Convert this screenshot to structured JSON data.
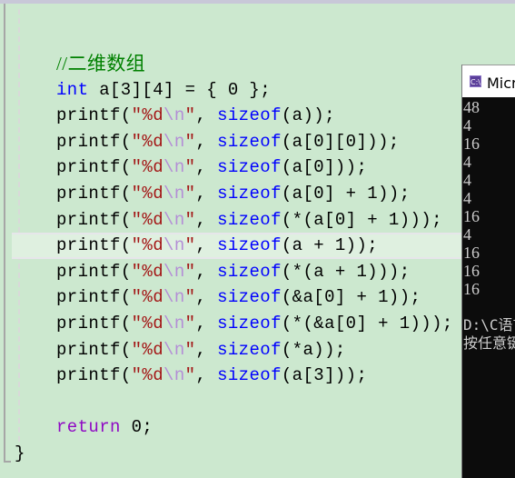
{
  "editor": {
    "comment": "//二维数组",
    "declaration": {
      "type": "int",
      "rest": " a[3][4] = { 0 };"
    },
    "printf_lines": [
      {
        "fn": "printf",
        "open": "(",
        "str_start": "″%d",
        "esc": "\\n",
        "str_end": "″",
        "sep": ", ",
        "sizeof": "sizeof",
        "arg": "(a));"
      },
      {
        "fn": "printf",
        "open": "(",
        "str_start": "″%d",
        "esc": "\\n",
        "str_end": "″",
        "sep": ", ",
        "sizeof": "sizeof",
        "arg": "(a[0][0]));"
      },
      {
        "fn": "printf",
        "open": "(",
        "str_start": "″%d",
        "esc": "\\n",
        "str_end": "″",
        "sep": ", ",
        "sizeof": "sizeof",
        "arg": "(a[0]));"
      },
      {
        "fn": "printf",
        "open": "(",
        "str_start": "″%d",
        "esc": "\\n",
        "str_end": "″",
        "sep": ", ",
        "sizeof": "sizeof",
        "arg": "(a[0] + 1));"
      },
      {
        "fn": "printf",
        "open": "(",
        "str_start": "″%d",
        "esc": "\\n",
        "str_end": "″",
        "sep": ", ",
        "sizeof": "sizeof",
        "arg": "(*(a[0] + 1)));"
      },
      {
        "fn": "printf",
        "open": "(",
        "str_start": "″%d",
        "esc": "\\n",
        "str_end": "″",
        "sep": ", ",
        "sizeof": "sizeof",
        "arg": "(a + 1));"
      },
      {
        "fn": "printf",
        "open": "(",
        "str_start": "″%d",
        "esc": "\\n",
        "str_end": "″",
        "sep": ", ",
        "sizeof": "sizeof",
        "arg": "(*(a + 1)));"
      },
      {
        "fn": "printf",
        "open": "(",
        "str_start": "″%d",
        "esc": "\\n",
        "str_end": "″",
        "sep": ", ",
        "sizeof": "sizeof",
        "arg": "(&a[0] + 1));"
      },
      {
        "fn": "printf",
        "open": "(",
        "str_start": "″%d",
        "esc": "\\n",
        "str_end": "″",
        "sep": ", ",
        "sizeof": "sizeof",
        "arg": "(*(&a[0] + 1)));"
      },
      {
        "fn": "printf",
        "open": "(",
        "str_start": "″%d",
        "esc": "\\n",
        "str_end": "″",
        "sep": ", ",
        "sizeof": "sizeof",
        "arg": "(*a));"
      },
      {
        "fn": "printf",
        "open": "(",
        "str_start": "″%d",
        "esc": "\\n",
        "str_end": "″",
        "sep": ", ",
        "sizeof": "sizeof",
        "arg": "(a[3]));"
      }
    ],
    "current_line_index": 5,
    "return_stmt": {
      "keyword": "return",
      "rest": " 0;"
    },
    "closing_brace": "}"
  },
  "console": {
    "icon": "C:\\",
    "title": "Microsoft Visual Studio 调试控制台",
    "output": [
      "48",
      "4",
      "16",
      "4",
      "4",
      "4",
      "16",
      "4",
      "16",
      "16",
      "16"
    ],
    "path_line": "D:\\C语言",
    "prompt_line": "按任意键关闭此窗口. . ."
  }
}
